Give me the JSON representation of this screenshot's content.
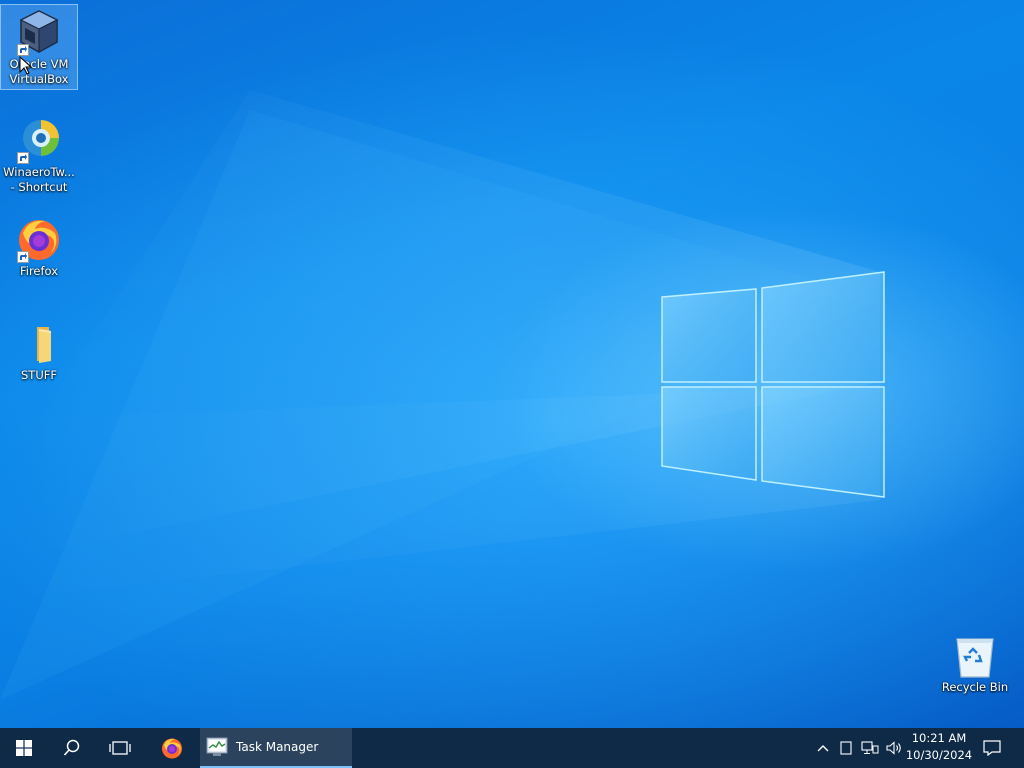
{
  "desktop": {
    "icons": [
      {
        "label": "Oracle VM\nVirtualBox",
        "name": "virtualbox",
        "selected": true
      },
      {
        "label": "WinaeroTw...\n- Shortcut",
        "name": "winaero-tweaker"
      },
      {
        "label": "Firefox",
        "name": "firefox"
      },
      {
        "label": "STUFF",
        "name": "stuff-folder"
      },
      {
        "label": "Recycle Bin",
        "name": "recycle-bin"
      }
    ]
  },
  "taskbar": {
    "start_icon": "windows-logo-icon",
    "search_icon": "search-icon",
    "taskview_icon": "task-view-icon",
    "pinned": [
      {
        "name": "firefox",
        "icon": "firefox-icon"
      }
    ],
    "running": [
      {
        "name": "task-manager",
        "title": "Task Manager",
        "icon": "task-manager-icon",
        "active": true
      }
    ],
    "tray": {
      "icons": [
        "chevron-up-icon",
        "tablet-icon",
        "network-icon",
        "volume-icon"
      ],
      "time": "10:21 AM",
      "date": "10/30/2024",
      "notification_icon": "notification-icon"
    }
  },
  "colors": {
    "taskbar_bg": "#0e2a47",
    "wallpaper_primary": "#0a86e8",
    "accent": "#7cc2ff"
  }
}
